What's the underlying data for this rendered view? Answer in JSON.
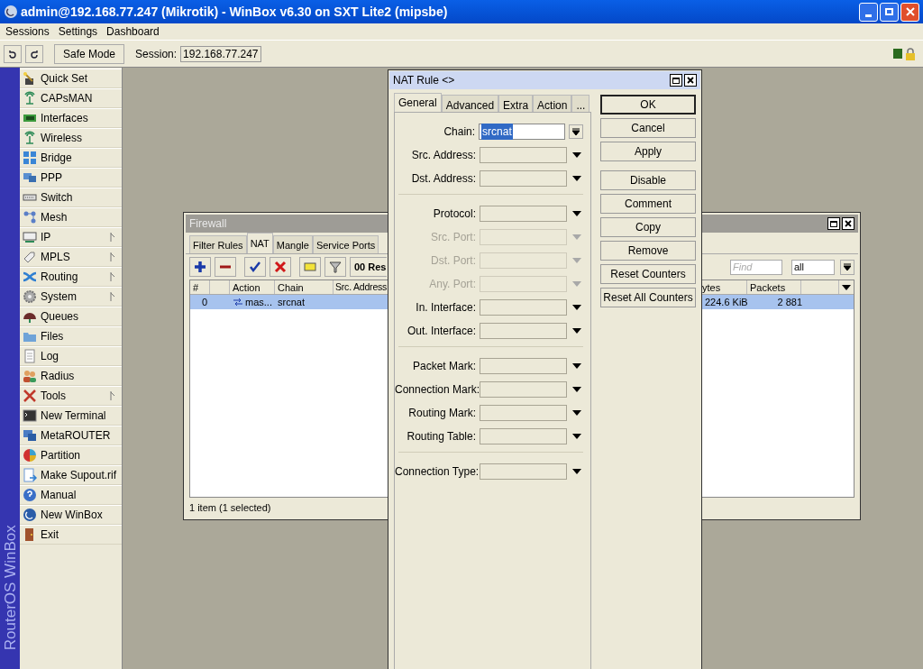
{
  "window": {
    "title": "admin@192.168.77.247 (Mikrotik) - WinBox v6.30 on SXT Lite2 (mipsbe)"
  },
  "menu": [
    "Sessions",
    "Settings",
    "Dashboard"
  ],
  "toolbar": {
    "safe_mode": "Safe Mode",
    "session_label": "Session:",
    "session_value": "192.168.77.247"
  },
  "sidebar": {
    "brand": "RouterOS WinBox",
    "items": [
      {
        "label": "Quick Set",
        "submenu": false
      },
      {
        "label": "CAPsMAN",
        "submenu": false
      },
      {
        "label": "Interfaces",
        "submenu": false
      },
      {
        "label": "Wireless",
        "submenu": false
      },
      {
        "label": "Bridge",
        "submenu": false
      },
      {
        "label": "PPP",
        "submenu": false
      },
      {
        "label": "Switch",
        "submenu": false
      },
      {
        "label": "Mesh",
        "submenu": false
      },
      {
        "label": "IP",
        "submenu": true
      },
      {
        "label": "MPLS",
        "submenu": true
      },
      {
        "label": "Routing",
        "submenu": true
      },
      {
        "label": "System",
        "submenu": true
      },
      {
        "label": "Queues",
        "submenu": false
      },
      {
        "label": "Files",
        "submenu": false
      },
      {
        "label": "Log",
        "submenu": false
      },
      {
        "label": "Radius",
        "submenu": false
      },
      {
        "label": "Tools",
        "submenu": true
      },
      {
        "label": "New Terminal",
        "submenu": false
      },
      {
        "label": "MetaROUTER",
        "submenu": false
      },
      {
        "label": "Partition",
        "submenu": false
      },
      {
        "label": "Make Supout.rif",
        "submenu": false
      },
      {
        "label": "Manual",
        "submenu": false
      },
      {
        "label": "New WinBox",
        "submenu": false
      },
      {
        "label": "Exit",
        "submenu": false
      }
    ]
  },
  "firewall": {
    "title": "Firewall",
    "active": false,
    "tabs": [
      {
        "label": "Filter Rules",
        "selected": false
      },
      {
        "label": "NAT",
        "selected": true
      },
      {
        "label": "Mangle",
        "selected": false
      },
      {
        "label": "Service Ports",
        "selected": false
      }
    ],
    "reset_button": "00 Res",
    "find_placeholder": "Find",
    "filter_value": "all",
    "columns_left": [
      "#",
      "Action",
      "Chain",
      "Src. Address"
    ],
    "columns_right": [
      "ytes",
      "Packets"
    ],
    "rows": [
      {
        "selected": true,
        "number": "0",
        "action": "mas...",
        "chain": "srcnat",
        "bytes": "224.6 KiB",
        "packets": "2 881"
      }
    ],
    "status": "1 item (1 selected)"
  },
  "nat_rule": {
    "title": "NAT Rule <>",
    "active": true,
    "tabs": [
      {
        "label": "General",
        "selected": true
      },
      {
        "label": "Advanced",
        "selected": false
      },
      {
        "label": "Extra",
        "selected": false
      },
      {
        "label": "Action",
        "selected": false
      },
      {
        "label": "...",
        "selected": false
      }
    ],
    "field_groups": [
      [
        {
          "label": "Chain:",
          "value": "srcnat",
          "disabled": false
        },
        {
          "label": "Src. Address:",
          "disabled": false
        },
        {
          "label": "Dst. Address:",
          "disabled": false
        }
      ],
      [
        {
          "label": "Protocol:",
          "disabled": false
        },
        {
          "label": "Src. Port:",
          "disabled": true
        },
        {
          "label": "Dst. Port:",
          "disabled": true
        },
        {
          "label": "Any. Port:",
          "disabled": true
        },
        {
          "label": "In. Interface:",
          "disabled": false
        },
        {
          "label": "Out. Interface:",
          "disabled": false
        }
      ],
      [
        {
          "label": "Packet Mark:",
          "disabled": false
        },
        {
          "label": "Connection Mark:",
          "disabled": false
        },
        {
          "label": "Routing Mark:",
          "disabled": false
        },
        {
          "label": "Routing Table:",
          "disabled": false
        }
      ],
      [
        {
          "label": "Connection Type:",
          "disabled": false
        }
      ]
    ],
    "button_groups": [
      [
        "OK",
        "Cancel",
        "Apply"
      ],
      [
        "Disable",
        "Comment",
        "Copy",
        "Remove",
        "Reset Counters",
        "Reset All Counters"
      ]
    ]
  }
}
